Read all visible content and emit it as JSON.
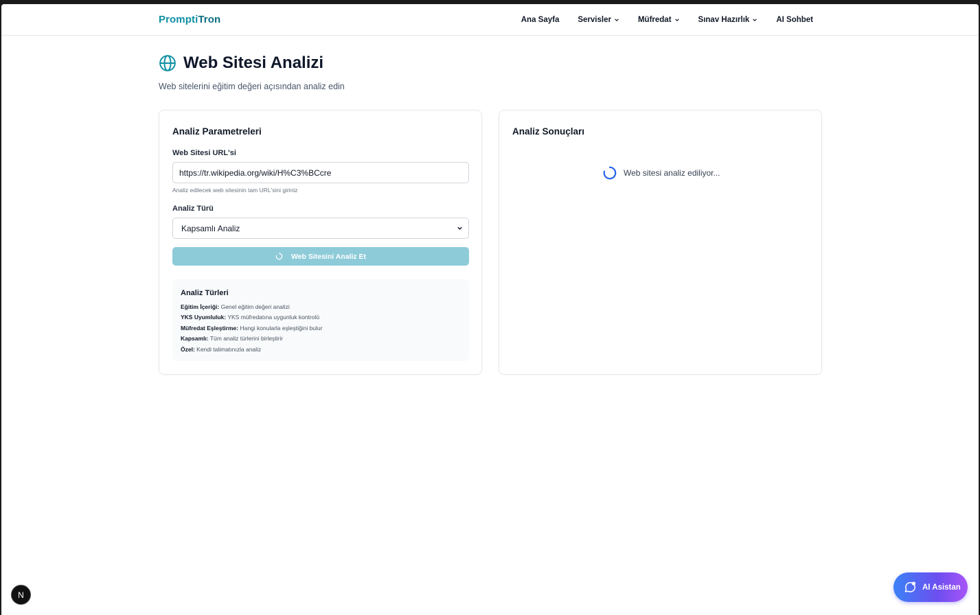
{
  "navbar": {
    "brand_part1": "Prompti",
    "brand_part2": "Tron",
    "items": [
      {
        "label": "Ana Sayfa"
      },
      {
        "label": "Servisler"
      },
      {
        "label": "Müfredat"
      },
      {
        "label": "Sınav Hazırlık"
      },
      {
        "label": "AI Sohbet"
      }
    ]
  },
  "header": {
    "title": "Web Sitesi Analizi",
    "subtitle": "Web sitelerini eğitim değeri açısından analiz edin",
    "icon": "globe-icon"
  },
  "params": {
    "title": "Analiz Parametreleri",
    "url_label": "Web Sitesi URL'si",
    "url_value": "https://tr.wikipedia.org/wiki/H%C3%BCcre",
    "url_hint": "Analiz edilecek web sitesinin tam URL'sini giriniz",
    "type_label": "Analiz Türü",
    "type_selected": "Kapsamlı Analiz",
    "button_label": "Web Sitesini Analiz Et",
    "types_box": {
      "title": "Analiz Türleri",
      "items": [
        {
          "name": "Eğitim İçeriği:",
          "desc": "Genel eğitim değeri analizi"
        },
        {
          "name": "YKS Uyumluluk:",
          "desc": "YKS müfredatına uygunluk kontrolü"
        },
        {
          "name": "Müfredat Eşleştirme:",
          "desc": "Hangi konularla eşleştiğini bulur"
        },
        {
          "name": "Kapsamlı:",
          "desc": "Tüm analiz türlerini birleştirir"
        },
        {
          "name": "Özel:",
          "desc": "Kendi talimatınızla analiz"
        }
      ]
    }
  },
  "results": {
    "title": "Analiz Sonuçları",
    "loading_text": "Web sitesi analiz ediliyor..."
  },
  "floating": {
    "assistant_label": "AI Asistan",
    "n_badge": "N"
  },
  "colors": {
    "brand": "#0e8fa3",
    "button_disabled": "#8ecbd8",
    "spinner": "#2563eb"
  }
}
